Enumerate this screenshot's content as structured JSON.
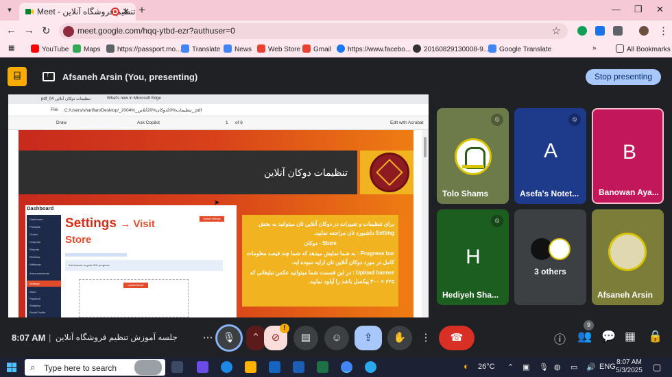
{
  "browser": {
    "tab_title": "Meet - تنظیم فروشگاه آنلاین",
    "url": "meet.google.com/hqq-ytbd-ezr?authuser=0",
    "bookmarks": [
      "YouTube",
      "Maps",
      "https://passport.mo...",
      "Translate",
      "News",
      "Web Store",
      "Gmail",
      "https://www.facebo...",
      "20160829130008-9...",
      "Google Translate"
    ],
    "all_bookmarks": "All Bookmarks"
  },
  "meet": {
    "presenter": "Afsaneh Arsin (You, presenting)",
    "stop_presenting": "Stop presenting",
    "time": "8:07 AM",
    "separator": "|",
    "meeting_title": "جلسه آموزش تنظیم فروشگاه آنلاین",
    "participant_count": "9",
    "warning_badge": "!"
  },
  "shared_screen": {
    "tabs": [
      "pdf_04 تنظیمات دوکان آنلاین",
      "What's new in Microsoft Edge"
    ],
    "file_label": "File",
    "file_path": "C:/Users/sharifian/Desktop/_2004%_تنظیمات%20دوکان%20آنلاین_.pdf",
    "toolbar": {
      "draw": "Draw",
      "ask_copilot": "Ask Copilot",
      "page_num": "1",
      "page_of": "of 6",
      "edit_acrobat": "Edit with Acrobat"
    },
    "doc_title": "تنظیمات دوکان آنلاین",
    "dashboard": "Dashboard",
    "settings_heading_part1": "Settings",
    "settings_heading_arrow": "→ Visit",
    "settings_heading_part2": "Store",
    "update_settings": "Update Settings",
    "upload_banner": "Upload Banner",
    "banner_hint": "Add banner to gain 15% progress",
    "sidebar_items": [
      "Dashboard",
      "Products",
      "Orders",
      "Coupons",
      "Reports",
      "Reviews",
      "Withdraw",
      "Announcements",
      "Settings",
      "Store",
      "Payment",
      "Shipping",
      "Social Profile"
    ],
    "text_lines": [
      "برای تنظیمات و تغییرات در دوکان آنلاین تان میتوانید به بخش Setting داشبورد تان مراجعه نمایید.",
      "Store - دوکان",
      "Progress bar : به شما نمایش میدهد که شما چند فیصد معلومات کامل در مورد دوکان آنلاین تان ارایه نموده اید.",
      "Upload banner : در این قسمت شما میتوانید عکس تبلیغاتی که ۶۲۵ × ۳۰۰ پیکسل باشد را آپلود نمایید."
    ]
  },
  "participants": [
    {
      "name": "Tolo Shams",
      "bg": "#6d7a4a",
      "muted": true,
      "kind": "logo"
    },
    {
      "name": "Asefa's Notet...",
      "bg": "#1e3a8a",
      "muted": true,
      "kind": "letter",
      "letter": "A"
    },
    {
      "name": "Banowan Aya...",
      "bg": "#c2185b",
      "muted": false,
      "kind": "letter",
      "letter": "B",
      "border": "#f8bbd0"
    },
    {
      "name": "Hediyeh Sha...",
      "bg": "#1b5e20",
      "muted": true,
      "kind": "letter",
      "letter": "H"
    },
    {
      "name": "3 others",
      "bg": "#3c4043",
      "muted": false,
      "kind": "group"
    },
    {
      "name": "Afsaneh Arsin",
      "bg": "#7d7d3a",
      "muted": false,
      "kind": "photo"
    }
  ],
  "taskbar": {
    "search_placeholder": "Type here to search",
    "weather": "26°C",
    "lang": "ENG",
    "clock_time": "8:07 AM",
    "clock_date": "5/3/2025"
  },
  "colors": {
    "accent_blue": "#a8c7fa",
    "hangup_red": "#d93025",
    "tab_pink": "#f6c9d6",
    "meet_bg": "#202124"
  }
}
